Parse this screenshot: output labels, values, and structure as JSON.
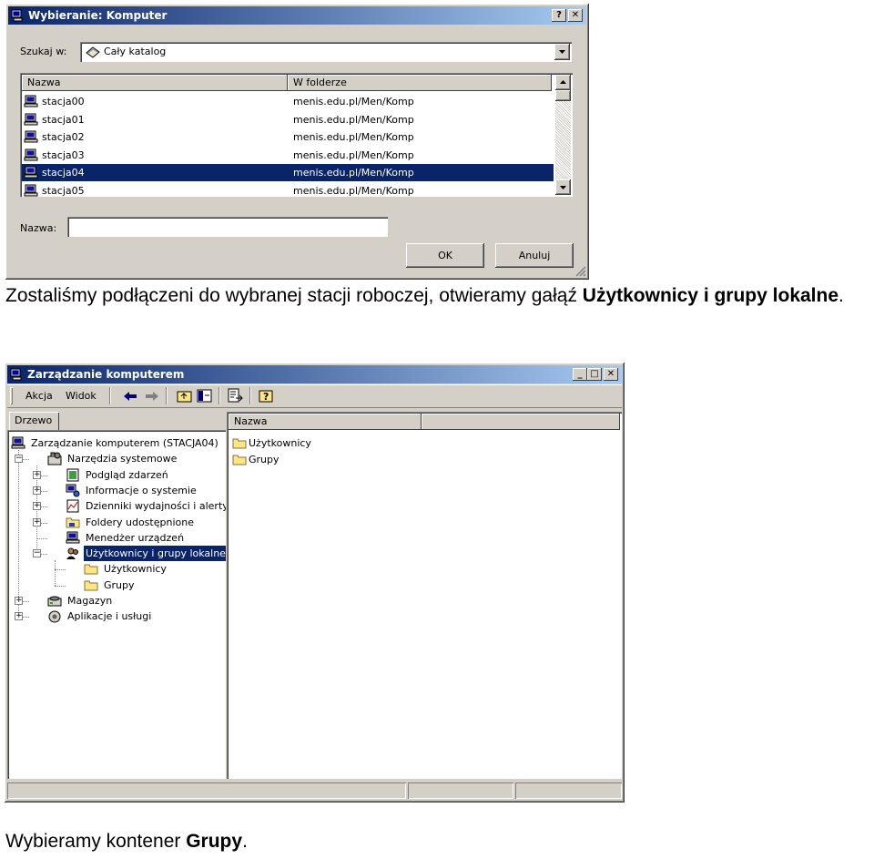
{
  "dialog": {
    "title": "Wybieranie: Komputer",
    "help_btn": "?",
    "close_btn": "✕",
    "look_in_label": "Szukaj w:",
    "look_in_value": "Cały katalog",
    "columns": [
      "Nazwa",
      "W folderze"
    ],
    "rows": [
      {
        "name": "stacja00",
        "folder": "menis.edu.pl/Men/Komp"
      },
      {
        "name": "stacja01",
        "folder": "menis.edu.pl/Men/Komp"
      },
      {
        "name": "stacja02",
        "folder": "menis.edu.pl/Men/Komp"
      },
      {
        "name": "stacja03",
        "folder": "menis.edu.pl/Men/Komp"
      },
      {
        "name": "stacja04",
        "folder": "menis.edu.pl/Men/Komp"
      },
      {
        "name": "stacja05",
        "folder": "menis.edu.pl/Men/Komp"
      }
    ],
    "selected_row": 4,
    "name_label": "Nazwa:",
    "name_value": "",
    "ok_label": "OK",
    "cancel_label": "Anuluj"
  },
  "caption1": {
    "text": "Zostaliśmy podłączeni do wybranej stacji roboczej, otwieramy gałąź ",
    "bold": "Użytkownicy i grupy lokalne",
    "end": "."
  },
  "mmc": {
    "title": "Zarządzanie komputerem",
    "min_btn": "_",
    "max_btn": "□",
    "close_btn": "✕",
    "menu": [
      "Akcja",
      "Widok"
    ],
    "tab": "Drzewo",
    "right_header": "Nazwa",
    "right_items": [
      "Użytkownicy",
      "Grupy"
    ],
    "tree": [
      {
        "label": "Zarządzanie komputerem (STACJA04)",
        "icon": "computer-management-icon"
      },
      {
        "label": "Narzędzia systemowe",
        "icon": "system-tools-icon"
      },
      {
        "label": "Podgląd zdarzeń",
        "icon": "event-viewer-icon"
      },
      {
        "label": "Informacje o systemie",
        "icon": "system-info-icon"
      },
      {
        "label": "Dzienniki wydajności i alerty",
        "icon": "performance-logs-icon"
      },
      {
        "label": "Foldery udostępnione",
        "icon": "shared-folders-icon"
      },
      {
        "label": "Menedżer urządzeń",
        "icon": "device-manager-icon"
      },
      {
        "label": "Użytkownicy i grupy lokalne",
        "icon": "local-users-groups-icon"
      },
      {
        "label": "Użytkownicy",
        "icon": "folder-icon"
      },
      {
        "label": "Grupy",
        "icon": "folder-icon"
      },
      {
        "label": "Magazyn",
        "icon": "storage-icon"
      },
      {
        "label": "Aplikacje i usługi",
        "icon": "services-applications-icon"
      }
    ]
  },
  "caption2": {
    "text": "Wybieramy kontener ",
    "bold": "Grupy",
    "end": "."
  }
}
